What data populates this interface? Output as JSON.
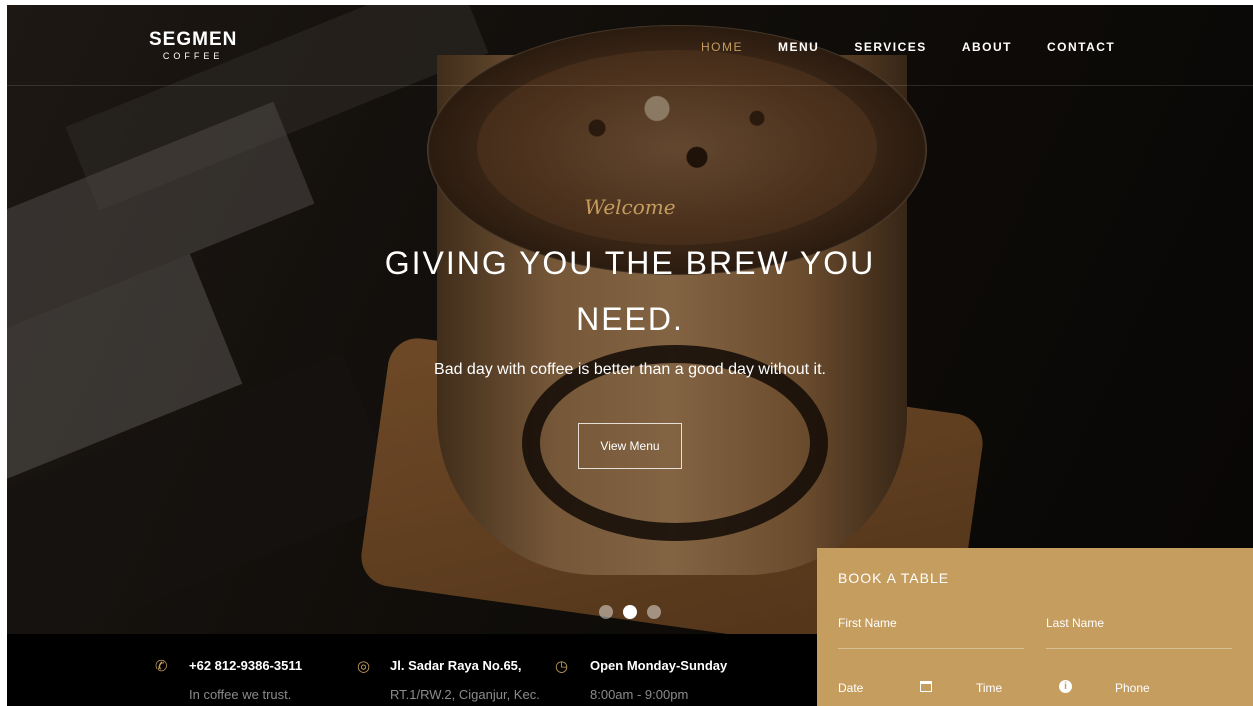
{
  "brand": {
    "name": "SEGMEN",
    "sub": "COFFEE"
  },
  "nav": {
    "items": [
      {
        "label": "HOME",
        "active": true
      },
      {
        "label": "MENU"
      },
      {
        "label": "SERVICES"
      },
      {
        "label": "ABOUT"
      },
      {
        "label": "CONTACT"
      }
    ]
  },
  "hero": {
    "welcome": "Welcome",
    "headline": "GIVING YOU THE BREW YOU NEED.",
    "subtitle": "Bad day with coffee is better than a good day without it.",
    "cta": "View Menu"
  },
  "slider": {
    "active_index": 1,
    "count": 3
  },
  "info": [
    {
      "icon": "phone-icon",
      "title": "+62 812-9386-3511",
      "detail": "In coffee we trust."
    },
    {
      "icon": "location-icon",
      "title": "Jl. Sadar Raya No.65,",
      "detail": "RT.1/RW.2, Ciganjur, Kec."
    },
    {
      "icon": "clock-icon",
      "title": "Open Monday-Sunday",
      "detail": "8:00am - 9:00pm"
    }
  ],
  "booking": {
    "title": "BOOK A TABLE",
    "first_name": "First Name",
    "last_name": "Last Name",
    "date": "Date",
    "time": "Time",
    "phone": "Phone"
  },
  "colors": {
    "accent": "#c59d5f",
    "bar": "#000000"
  }
}
